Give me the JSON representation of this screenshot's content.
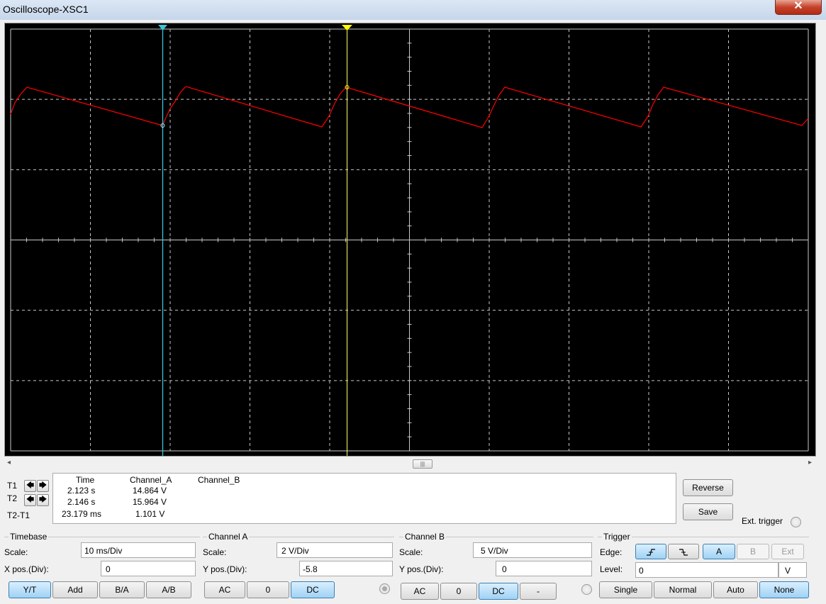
{
  "window": {
    "title": "Oscilloscope-XSC1",
    "close_glyph": "✕"
  },
  "colors": {
    "screen_bg": "#000000",
    "grid": "#c8c8c8",
    "trace_a": "#ff0000",
    "cursor_1": "#37c6d8",
    "cursor_2": "#ffff00",
    "accent_blue": "#9fd2f4"
  },
  "cursors": {
    "t1_label": "T1",
    "t2_label": "T2",
    "diff_label": "T2-T1",
    "left_icon": "arrow-left-icon",
    "right_icon": "arrow-right-icon"
  },
  "readout": {
    "headers": {
      "time": "Time",
      "channel_a": "Channel_A",
      "channel_b": "Channel_B"
    },
    "rows": [
      {
        "time": "2.123 s",
        "channel_a": "14.864 V",
        "channel_b": ""
      },
      {
        "time": "2.146 s",
        "channel_a": "15.964 V",
        "channel_b": ""
      },
      {
        "time": "23.179 ms",
        "channel_a": "1.101 V",
        "channel_b": ""
      }
    ]
  },
  "actions": {
    "reverse": "Reverse",
    "save": "Save",
    "ext_trigger": "Ext. trigger"
  },
  "timebase": {
    "title": "Timebase",
    "scale_label": "Scale:",
    "scale_value": "10 ms/Div",
    "xpos_label": "X pos.(Div):",
    "xpos_value": "0",
    "modes": [
      "Y/T",
      "Add",
      "B/A",
      "A/B"
    ],
    "active_mode": "Y/T"
  },
  "channel_a": {
    "title": "Channel A",
    "scale_label": "Scale:",
    "scale_value": "2  V/Div",
    "ypos_label": "Y pos.(Div):",
    "ypos_value": "-5.8",
    "coupling": [
      "AC",
      "0",
      "DC"
    ],
    "active_coupling": "DC"
  },
  "channel_b": {
    "title": "Channel B",
    "scale_label": "Scale:",
    "scale_value": "5  V/Div",
    "ypos_label": "Y pos.(Div):",
    "ypos_value": "0",
    "coupling": [
      "AC",
      "0",
      "DC",
      "-"
    ],
    "active_coupling": "DC"
  },
  "trigger": {
    "title": "Trigger",
    "edge_label": "Edge:",
    "rising_icon": "rising-edge-icon",
    "falling_icon": "falling-edge-icon",
    "sources": [
      "A",
      "B",
      "Ext"
    ],
    "active_source": "A",
    "level_label": "Level:",
    "level_value": "0",
    "level_unit": "V",
    "modes": [
      "Single",
      "Normal",
      "Auto",
      "None"
    ],
    "active_mode": "None"
  },
  "scroll": {
    "thumb_glyph": "|||",
    "left_glyph": "◂",
    "right_glyph": "▸"
  }
}
